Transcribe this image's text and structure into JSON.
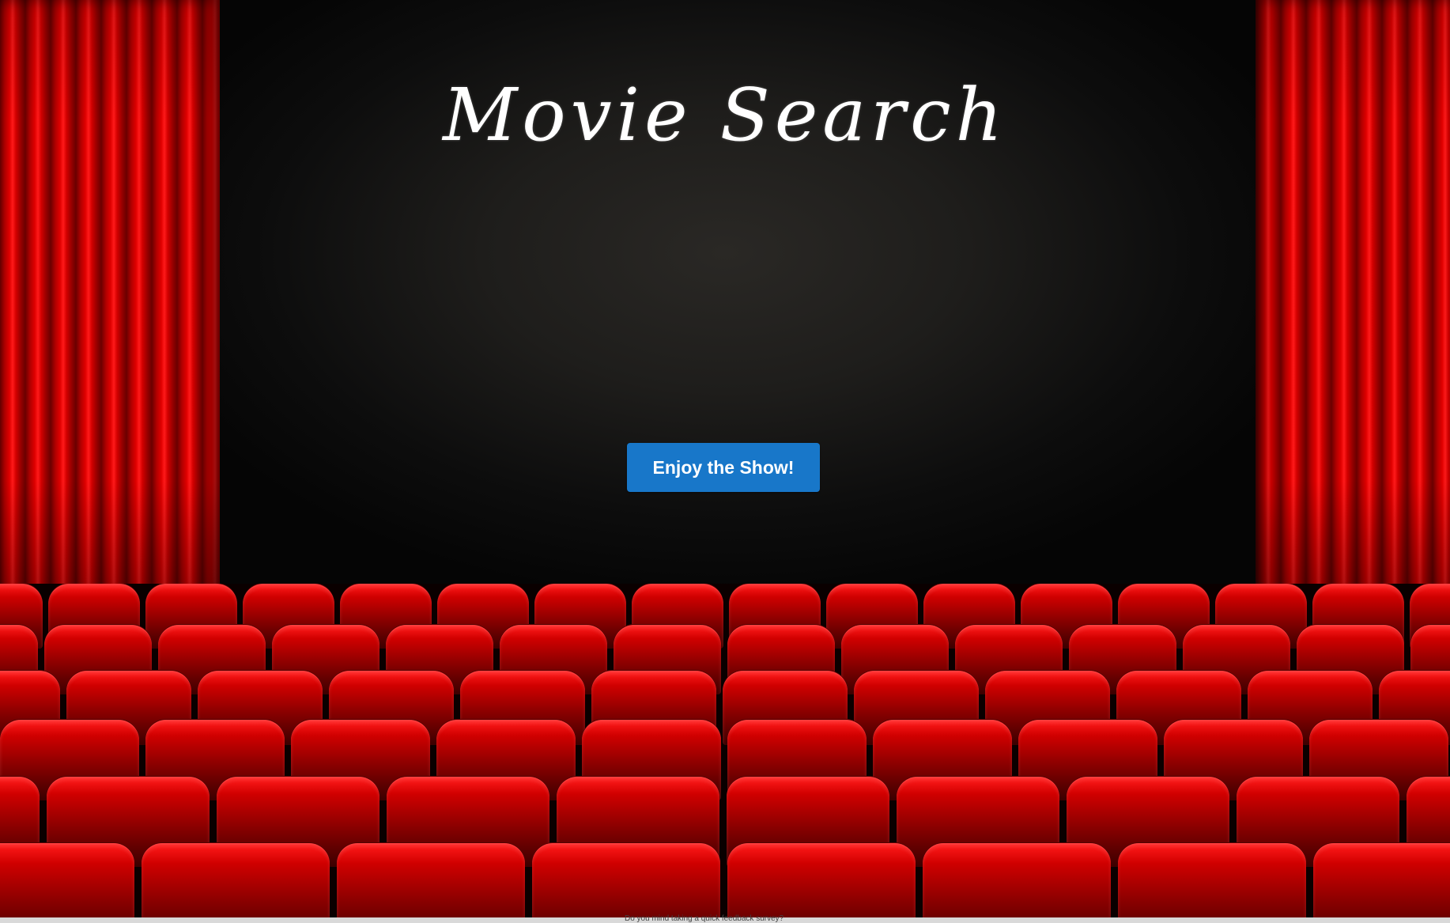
{
  "app": {
    "title": "Movie Search"
  },
  "hero": {
    "button_label": "Enjoy the Show!"
  },
  "footer": {
    "survey_text": "Do you mind taking a quick feedback survey?"
  },
  "colors": {
    "curtain": "#d00000",
    "seat": "#c40000",
    "button": "#1877c9",
    "screen": "#1e1d1b"
  }
}
